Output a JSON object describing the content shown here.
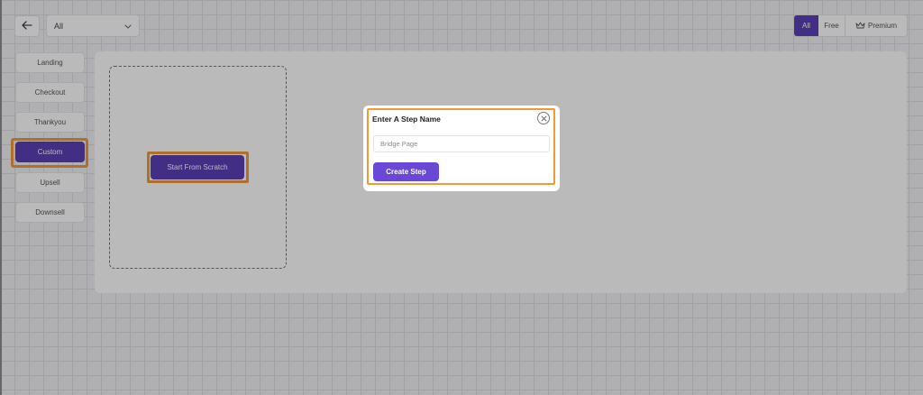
{
  "toolbar": {
    "filter_value": "All",
    "plan_tabs": [
      {
        "label": "All",
        "active": true
      },
      {
        "label": "Free",
        "active": false
      },
      {
        "label": "Premium",
        "active": false
      }
    ]
  },
  "sidebar": {
    "items": [
      {
        "label": "Landing",
        "active": false
      },
      {
        "label": "Checkout",
        "active": false
      },
      {
        "label": "Thankyou",
        "active": false
      },
      {
        "label": "Custom",
        "active": true
      },
      {
        "label": "Upsell",
        "active": false
      },
      {
        "label": "Downsell",
        "active": false
      }
    ]
  },
  "main": {
    "start_button_label": "Start From Scratch"
  },
  "modal": {
    "title": "Enter A Step Name",
    "input_placeholder": "Bridge Page",
    "input_value": "",
    "submit_label": "Create Step"
  },
  "colors": {
    "accent": "#5b3fb5",
    "button": "#6a48d7",
    "highlight": "#f29a3a"
  },
  "icons": {
    "back": "arrow-left-icon",
    "dropdown": "chevron-down-icon",
    "premium": "crown-icon",
    "close": "close-icon"
  }
}
